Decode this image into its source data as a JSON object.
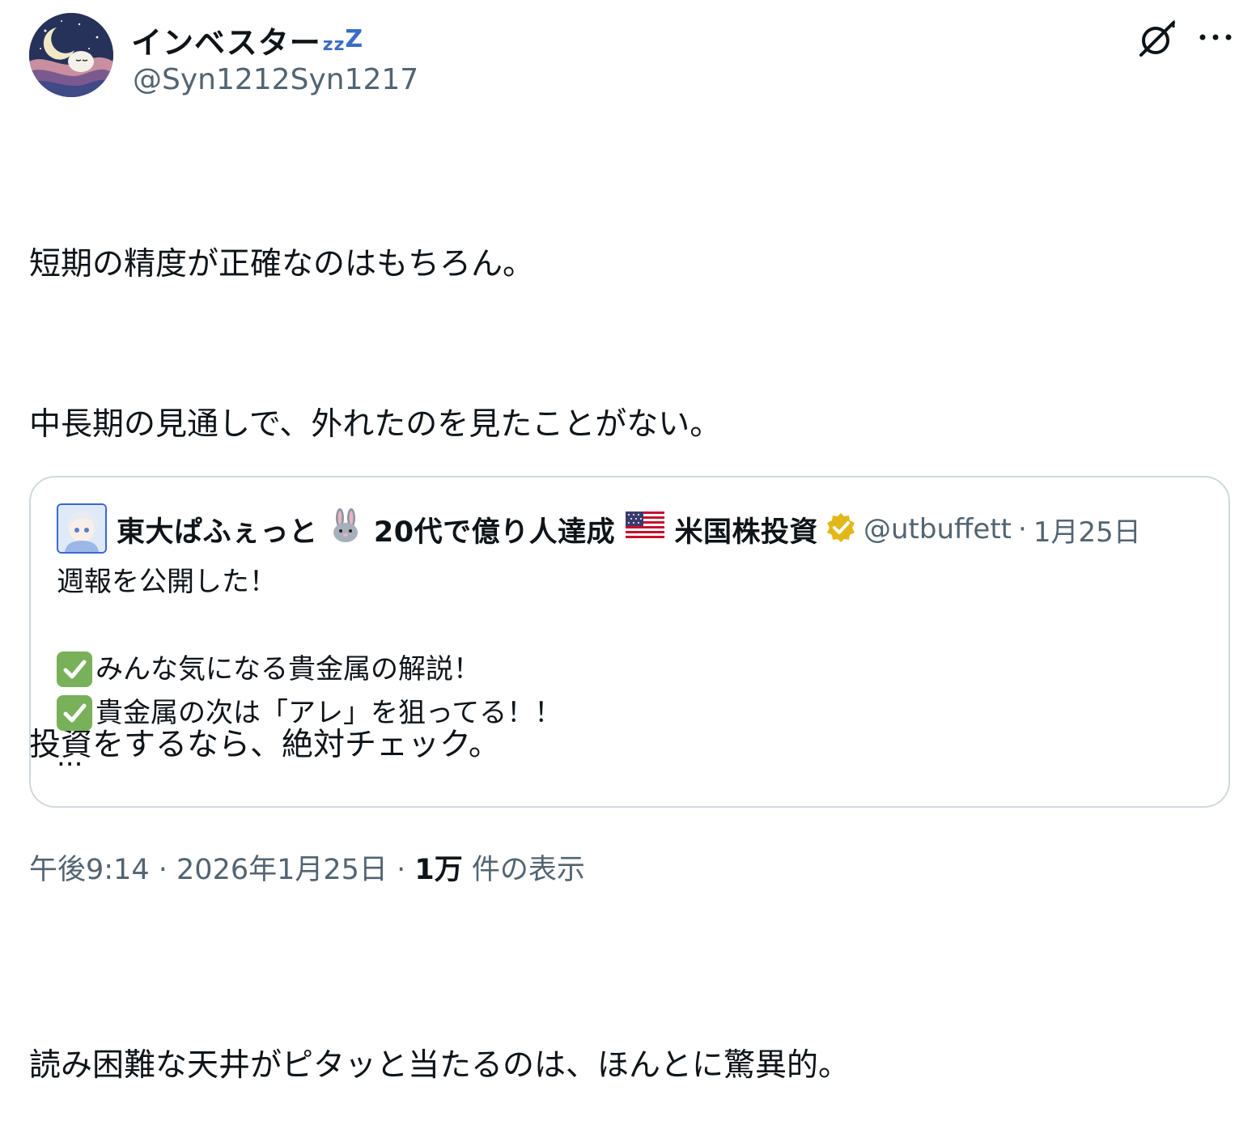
{
  "author": {
    "display_name": "インベスター",
    "sleep_small": "zz",
    "sleep_big": "Z",
    "handle": "@Syn1212Syn1217"
  },
  "actions": {
    "grok_icon": "grok-icon",
    "more_icon": "more-icon",
    "more_label": "···"
  },
  "post": {
    "lines": [
      "短期の精度が正確なのはもちろん。",
      "中長期の見通しで、外れたのを見たことがない。",
      "",
      "投資をするなら、絶対チェック。",
      "",
      "読み困難な天井がピタッと当たるのは、ほんとに驚異的。"
    ]
  },
  "quote": {
    "name_part1": "東大ぱふぇっと",
    "name_part2": "20代で億り人達成",
    "name_part3": "米国株投資",
    "handle": "@utbuffett",
    "separator": "·",
    "date": "1月25日",
    "line1": "週報を公開した！",
    "line2": "みんな気になる貴金属の解説！",
    "line3": "貴金属の次は「アレ」を狙ってる！！",
    "ellipsis": "...",
    "verified_color": "#e2b719"
  },
  "meta": {
    "time": "午後9:14",
    "dot1": "·",
    "date": "2026年1月25日",
    "dot2": "·",
    "views": "1万",
    "views_suffix": "件の表示"
  }
}
